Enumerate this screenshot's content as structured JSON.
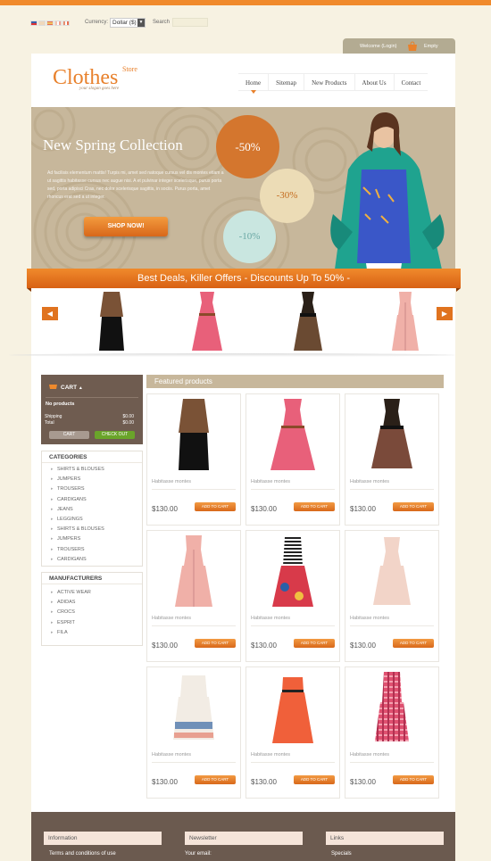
{
  "topbar": {
    "flags": [
      {
        "name": "us-flag-icon",
        "color": "#3b5fa8"
      },
      {
        "name": "de-flag-icon",
        "color": "#e8c8a0"
      },
      {
        "name": "es-flag-icon",
        "color": "#e87050"
      },
      {
        "name": "fr-flag-icon",
        "color": "#f0c0b0"
      },
      {
        "name": "it-flag-icon",
        "color": "#e89070"
      }
    ],
    "currency_label": "Currency:",
    "currency_value": "Dollar ($)",
    "search_label": "Search"
  },
  "account": {
    "welcome": "Welcome (Login)",
    "cart_status": "Empty"
  },
  "logo": {
    "name": "Clothes",
    "store": "Store",
    "slogan": "your slogan goes here"
  },
  "nav": {
    "items": [
      "Home",
      "Sitemap",
      "New Products",
      "About Us",
      "Contact"
    ],
    "active": "Home"
  },
  "hero": {
    "title": "New Spring Collection",
    "text": "Ad facilisis elementum mattis! Turpis mi, amet sed natoque cursus vel dis montes etiam a ut sagittis habitasse cursus nec augue nisi. A et pulvinar integer scelerisque, purus porta sed, porta adipisci Cras, nec dolor scelerisque sagittis, in sociis. Purus porta, amet rhoncus erat sed a ut integer.",
    "button": "SHOP NOW!",
    "discounts": [
      "-50%",
      "-30%",
      "-10%"
    ]
  },
  "ribbon": {
    "text": "Best Deals, Killer Offers  -  Discounts Up To 50% -"
  },
  "carousel": {
    "prev": "◀",
    "next": "▶"
  },
  "cart": {
    "title": "CART",
    "empty_text": "No products",
    "shipping_label": "Shipping",
    "shipping_value": "$0.00",
    "total_label": "Total",
    "total_value": "$0.00",
    "cart_button": "CART",
    "checkout_button": "CHECK OUT"
  },
  "categories": {
    "title": "CATEGORIES",
    "items": [
      "SHIRTS & BLOUSES",
      "JUMPERS",
      "TROUSERS",
      "CARDIGANS",
      "JEANS",
      "LEGGINGS",
      "SHIRTS & BLOUSES",
      "JUMPERS",
      "TROUSERS",
      "CARDIGANS"
    ]
  },
  "manufacturers": {
    "title": "MANUFACTURERS",
    "items": [
      "ACTIVE WEAR",
      "ADIDAS",
      "CROCS",
      "ESPRIT",
      "FILA"
    ]
  },
  "featured": {
    "title": "Featured products",
    "add_label": "ADD TO CART",
    "products": [
      {
        "name": "Habitasse montes",
        "price": "$130.00"
      },
      {
        "name": "Habitasse montes",
        "price": "$130.00"
      },
      {
        "name": "Habitasse montes",
        "price": "$130.00"
      },
      {
        "name": "Habitasse montes",
        "price": "$130.00"
      },
      {
        "name": "Habitasse montes",
        "price": "$130.00"
      },
      {
        "name": "Habitasse montes",
        "price": "$130.00"
      },
      {
        "name": "Habitasse montes",
        "price": "$130.00"
      },
      {
        "name": "Habitasse montes",
        "price": "$130.00"
      },
      {
        "name": "Habitasse montes",
        "price": "$130.00"
      }
    ]
  },
  "footer": {
    "columns": [
      {
        "title": "Information",
        "first_link": "Terms and conditions of use"
      },
      {
        "title": "Newsletter",
        "first_link": "Your email:"
      },
      {
        "title": "Links",
        "first_link": "Specials"
      }
    ]
  },
  "colors": {
    "accent": "#f08a2c",
    "page_bg": "#f7f2e2",
    "panel_tan": "#c7b79b",
    "footer_brown": "#6b5a4f"
  }
}
